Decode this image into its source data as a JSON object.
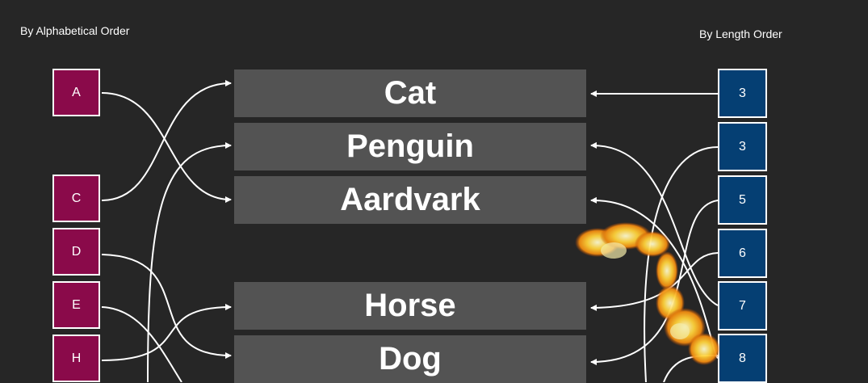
{
  "headings": {
    "left": "By Alphabetical Order",
    "right": "By Length Order"
  },
  "left_keys": [
    "A",
    "C",
    "D",
    "E",
    "H"
  ],
  "words": [
    "Cat",
    "Penguin",
    "Aardvark",
    "Horse",
    "Dog"
  ],
  "right_keys": [
    "3",
    "3",
    "5",
    "6",
    "7",
    "8"
  ],
  "colors": {
    "background": "#262626",
    "left_key_fill": "#8a0a4a",
    "right_key_fill": "#053f73",
    "word_fill": "#535353",
    "arrow": "#ffffff"
  },
  "decoration": "fire-effect"
}
